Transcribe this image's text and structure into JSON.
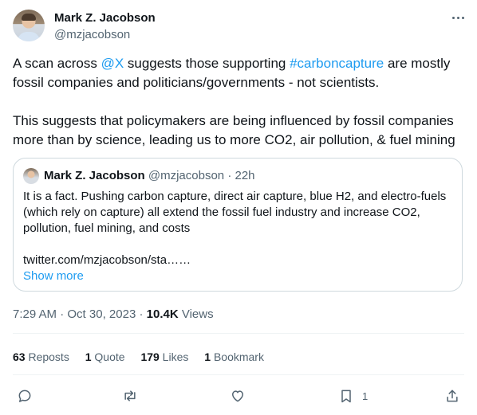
{
  "author": {
    "name": "Mark Z. Jacobson",
    "handle": "@mzjacobson"
  },
  "tweet": {
    "line1_prefix": "A scan across ",
    "line1_mention": "@X",
    "line1_mid": " suggests those supporting ",
    "line1_hashtag": "#carboncapture",
    "line1_suffix": " are mostly fossil companies and politicians/governments - not scientists.",
    "paragraph2": "This suggests that policymakers are being influenced by fossil companies more than by science, leading us to more CO2, air pollution, & fuel mining"
  },
  "quote": {
    "name": "Mark Z. Jacobson",
    "handle": "@mzjacobson",
    "sep": " · ",
    "time": "22h",
    "text": "It is a fact. Pushing carbon capture, direct air capture, blue H2, and electro-fuels (which rely on capture) all extend the fossil fuel industry and increase CO2, pollution, fuel mining, and costs",
    "link": "twitter.com/mzjacobson/sta……",
    "show_more": "Show more"
  },
  "meta": {
    "time": "7:29 AM",
    "sep": " · ",
    "date": "Oct 30, 2023",
    "sep2": " · ",
    "views_count": "10.4K",
    "views_label": " Views"
  },
  "stats": {
    "reposts_count": "63",
    "reposts_label": " Reposts",
    "quotes_count": "1",
    "quotes_label": " Quote",
    "likes_count": "179",
    "likes_label": " Likes",
    "bookmarks_count": "1",
    "bookmarks_label": " Bookmark"
  },
  "actions": {
    "reply_icon": "reply-icon",
    "repost_icon": "repost-icon",
    "like_icon": "heart-icon",
    "bookmark_icon": "bookmark-icon",
    "bookmark_count": "1",
    "share_icon": "share-icon"
  },
  "colors": {
    "link": "#1d9bf0",
    "text": "#0f1419",
    "secondary": "#536471",
    "border": "#cfd9de"
  }
}
